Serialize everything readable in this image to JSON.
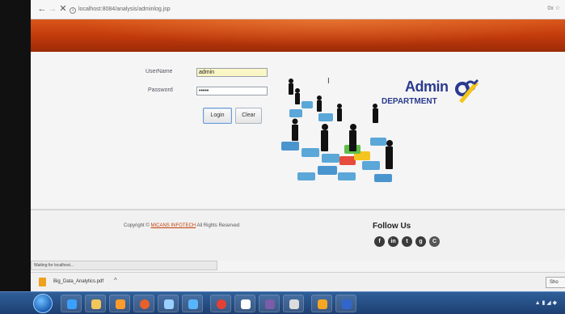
{
  "browser": {
    "url": "localhost:8084/analysis/adminlog.jsp",
    "addr_right": "0x ☆",
    "back_icon": "back-arrow-icon",
    "forward_icon": "forward-arrow-icon",
    "close_icon": "close-icon"
  },
  "login": {
    "username_label": "UserName",
    "username_value": "admin",
    "password_label": "Password",
    "password_value": "•••••",
    "login_button": "Login",
    "clear_button": "Clear"
  },
  "logo": {
    "title": "Admin",
    "subtitle": "DEPARTMENT"
  },
  "footer": {
    "copyright_prefix": "Copyright ©",
    "company": "MICANS INFOTECH",
    "copyright_suffix": "All Rights Reserved",
    "follow_us": "Follow Us",
    "social": [
      "f",
      "in",
      "t",
      "g",
      "C"
    ]
  },
  "status": {
    "text": "Waiting for localhost..."
  },
  "downloads": {
    "file_name": "Big_Data_Analytics.pdf",
    "show_all": "Sho"
  },
  "colors": {
    "banner": "#c0390b",
    "logo": "#2a3a8e",
    "accent_link": "#c2410c"
  }
}
